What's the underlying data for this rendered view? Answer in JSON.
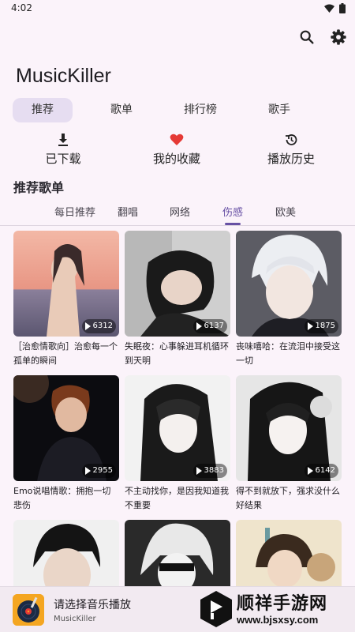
{
  "status_bar": {
    "time": "4:02"
  },
  "app": {
    "title": "MusicKiller"
  },
  "main_tabs": [
    {
      "label": "推荐",
      "active": true
    },
    {
      "label": "歌单",
      "active": false
    },
    {
      "label": "排行榜",
      "active": false
    },
    {
      "label": "歌手",
      "active": false
    }
  ],
  "quick_actions": [
    {
      "label": "已下载",
      "icon": "download-icon"
    },
    {
      "label": "我的收藏",
      "icon": "heart-icon"
    },
    {
      "label": "播放历史",
      "icon": "history-icon"
    }
  ],
  "section": {
    "title": "推荐歌单"
  },
  "sub_tabs": [
    {
      "label": "每日推荐",
      "active": false
    },
    {
      "label": "翻唱",
      "active": false
    },
    {
      "label": "网络",
      "active": false
    },
    {
      "label": "伤感",
      "active": true
    },
    {
      "label": "欧美",
      "active": false
    }
  ],
  "playlists": [
    {
      "title": "［治愈情歌向］治愈每一个孤单的瞬间",
      "plays": "6312"
    },
    {
      "title": "失眠夜：心事躲进耳机循环到天明",
      "plays": "6137"
    },
    {
      "title": "丧味嘻哈：在流泪中接受这一切",
      "plays": "1875"
    },
    {
      "title": "Emo说唱情歌：拥抱一切悲伤",
      "plays": "2955"
    },
    {
      "title": "不主动找你，是因我知道我不重要",
      "plays": "3883"
    },
    {
      "title": "得不到就放下，强求没什么好结果",
      "plays": "6142"
    },
    {
      "title": "",
      "plays": ""
    },
    {
      "title": "",
      "plays": ""
    },
    {
      "title": "",
      "plays": ""
    }
  ],
  "now_playing": {
    "title": "请选择音乐播放",
    "subtitle": "MusicKiller"
  },
  "watermark": {
    "brand": "顺祥手游网",
    "url": "www.bjsxsy.com"
  },
  "colors": {
    "accent": "#6750a4",
    "background": "#fbf3fa",
    "heart": "#e53935"
  }
}
